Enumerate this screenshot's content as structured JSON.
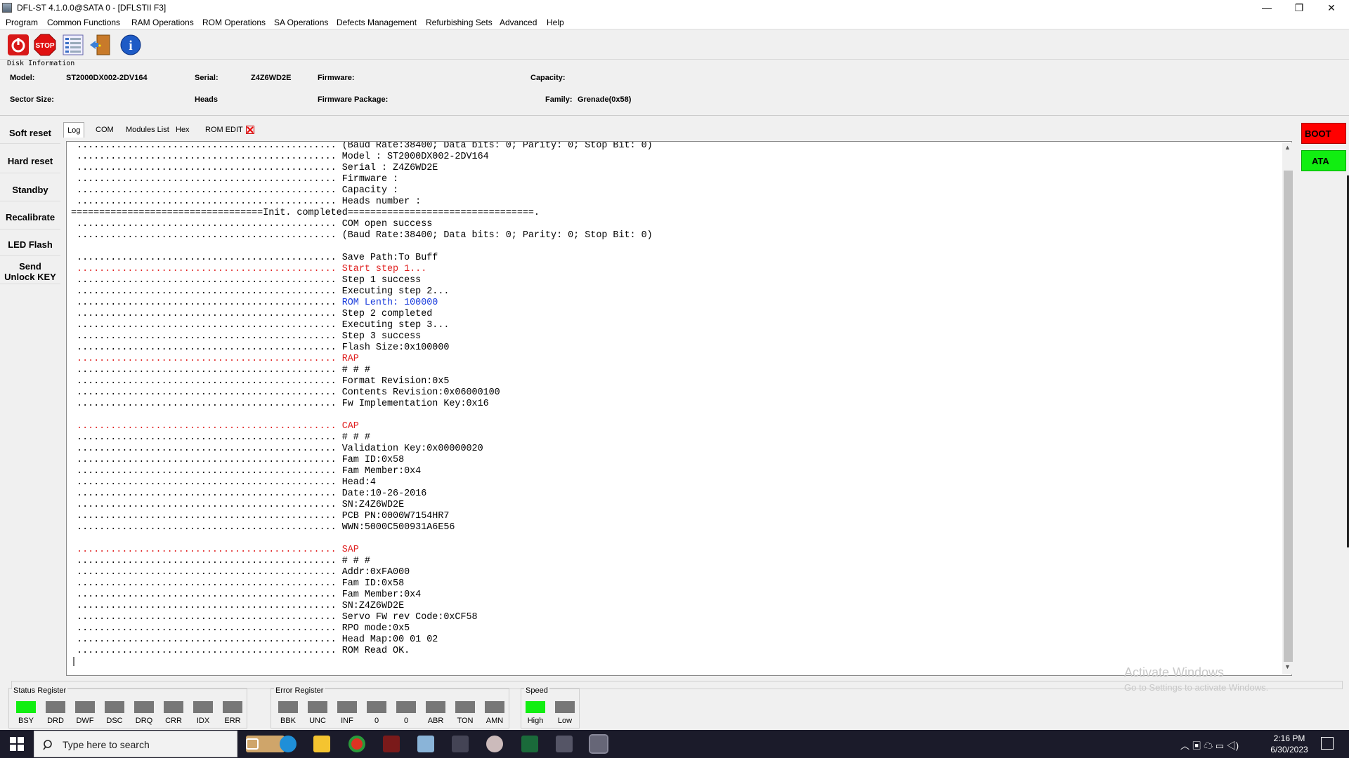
{
  "window": {
    "title": "DFL-ST 4.1.0.0@SATA 0 - [DFLSTII  F3]",
    "minimize": "—",
    "maximize": "❐",
    "close": "✕"
  },
  "menu": [
    "Program",
    "Common Functions",
    "RAM Operations",
    "ROM Operations",
    "SA Operations",
    "Defects Management",
    "Refurbishing Sets",
    "Advanced",
    "Help"
  ],
  "toolbar": {
    "icons": [
      "power-icon",
      "stop-icon",
      "list-icon",
      "exit-door-icon",
      "info-icon"
    ],
    "stop_label": "STOP",
    "info_label": "i"
  },
  "disk_info": {
    "group_label": "Disk Information",
    "model_label": "Model:",
    "model_value": "ST2000DX002-2DV164",
    "serial_label": "Serial:",
    "serial_value": "Z4Z6WD2E",
    "firmware_label": "Firmware:",
    "firmware_value": "",
    "capacity_label": "Capacity:",
    "capacity_value": "",
    "sector_label": "Sector Size:",
    "sector_value": "",
    "heads_label": "Heads",
    "heads_value": "",
    "fwpkg_label": "Firmware Package:",
    "fwpkg_value": "",
    "family_label": "Family:",
    "family_value": "Grenade(0x58)"
  },
  "left_buttons": [
    "Soft reset",
    "Hard reset",
    "Standby",
    "Recalibrate",
    "LED Flash",
    "Send\nUnlock KEY"
  ],
  "tabs": [
    "Log",
    "COM",
    "Modules List",
    "Hex",
    "ROM EDIT"
  ],
  "right_buttons": {
    "boot": "BOOT",
    "ata": "ATA"
  },
  "log": {
    "dots": "..............................................",
    "init_line": "==================================Init. completed=================================.",
    "lines": [
      {
        "text": "(Baud Rate:38400; Data bits: 0; Parity: 0; Stop Bit: 0)",
        "color": "black"
      },
      {
        "text": "Model : ST2000DX002-2DV164",
        "color": "black"
      },
      {
        "text": "Serial : Z4Z6WD2E",
        "color": "black"
      },
      {
        "text": "Firmware :",
        "color": "black"
      },
      {
        "text": "Capacity :",
        "color": "black"
      },
      {
        "text": "Heads number :",
        "color": "black"
      },
      {
        "text": "",
        "color": "init"
      },
      {
        "text": "COM open success",
        "color": "black"
      },
      {
        "text": "(Baud Rate:38400; Data bits: 0; Parity: 0; Stop Bit: 0)",
        "color": "black"
      },
      {
        "text": "",
        "color": "blank"
      },
      {
        "text": "Save Path:To Buff",
        "color": "black"
      },
      {
        "text": "Start step 1...",
        "color": "red"
      },
      {
        "text": "Step 1 success",
        "color": "black"
      },
      {
        "text": "Executing step 2...",
        "color": "black"
      },
      {
        "text": "ROM Lenth: 100000",
        "color": "blue"
      },
      {
        "text": "Step 2 completed",
        "color": "black"
      },
      {
        "text": "Executing step 3...",
        "color": "black"
      },
      {
        "text": "Step 3 success",
        "color": "black"
      },
      {
        "text": "Flash Size:0x100000",
        "color": "black"
      },
      {
        "text": "RAP",
        "color": "red"
      },
      {
        "text": "# # #",
        "color": "black"
      },
      {
        "text": "Format Revision:0x5",
        "color": "black"
      },
      {
        "text": "Contents Revision:0x06000100",
        "color": "black"
      },
      {
        "text": "Fw Implementation Key:0x16",
        "color": "black"
      },
      {
        "text": "",
        "color": "blank"
      },
      {
        "text": "CAP",
        "color": "red"
      },
      {
        "text": "# # #",
        "color": "black"
      },
      {
        "text": "Validation Key:0x00000020",
        "color": "black"
      },
      {
        "text": "Fam ID:0x58",
        "color": "black"
      },
      {
        "text": "Fam Member:0x4",
        "color": "black"
      },
      {
        "text": "Head:4",
        "color": "black"
      },
      {
        "text": "Date:10-26-2016",
        "color": "black"
      },
      {
        "text": "SN:Z4Z6WD2E",
        "color": "black"
      },
      {
        "text": "PCB PN:0000W7154HR7",
        "color": "black"
      },
      {
        "text": "WWN:5000C500931A6E56",
        "color": "black"
      },
      {
        "text": "",
        "color": "blank"
      },
      {
        "text": "SAP",
        "color": "red"
      },
      {
        "text": "# # #",
        "color": "black"
      },
      {
        "text": "Addr:0xFA000",
        "color": "black"
      },
      {
        "text": "Fam ID:0x58",
        "color": "black"
      },
      {
        "text": "Fam Member:0x4",
        "color": "black"
      },
      {
        "text": "SN:Z4Z6WD2E",
        "color": "black"
      },
      {
        "text": "Servo FW rev Code:0xCF58",
        "color": "black"
      },
      {
        "text": "RPO mode:0x5",
        "color": "black"
      },
      {
        "text": "Head Map:00 01 02",
        "color": "black"
      },
      {
        "text": "ROM Read OK.",
        "color": "black"
      }
    ]
  },
  "status_register": {
    "label": "Status Register",
    "leds": [
      {
        "name": "BSY",
        "on": true
      },
      {
        "name": "DRD",
        "on": false
      },
      {
        "name": "DWF",
        "on": false
      },
      {
        "name": "DSC",
        "on": false
      },
      {
        "name": "DRQ",
        "on": false
      },
      {
        "name": "CRR",
        "on": false
      },
      {
        "name": "IDX",
        "on": false
      },
      {
        "name": "ERR",
        "on": false
      }
    ]
  },
  "error_register": {
    "label": "Error Register",
    "leds": [
      {
        "name": "BBK",
        "on": false
      },
      {
        "name": "UNC",
        "on": false
      },
      {
        "name": "INF",
        "on": false
      },
      {
        "name": "0",
        "on": false
      },
      {
        "name": "0",
        "on": false
      },
      {
        "name": "ABR",
        "on": false
      },
      {
        "name": "TON",
        "on": false
      },
      {
        "name": "AMN",
        "on": false
      }
    ]
  },
  "speed": {
    "label": "Speed",
    "leds": [
      {
        "name": "High",
        "on": true
      },
      {
        "name": "Low",
        "on": false
      }
    ]
  },
  "watermark": {
    "line1": "Activate Windows",
    "line2": "Go to Settings to activate Windows."
  },
  "taskbar": {
    "search_placeholder": "Type here to search",
    "time": "2:16 PM",
    "date": "6/30/2023"
  },
  "colors": {
    "boot": "#ff0000",
    "ata": "#11ee11",
    "led_on": "#11ee11",
    "led_off": "#777777",
    "log_red": "#e02020",
    "log_blue": "#1a3cdc"
  }
}
